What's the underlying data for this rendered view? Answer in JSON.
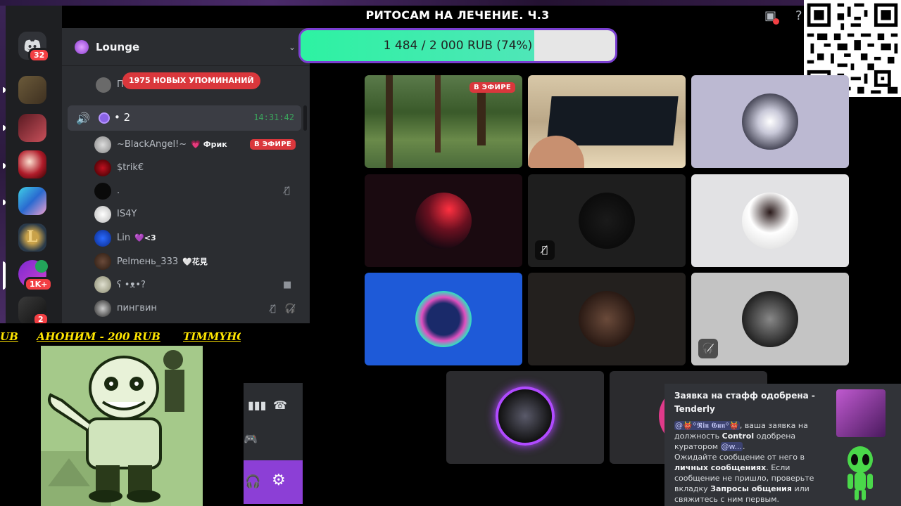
{
  "stream": {
    "title": "РИТОСАМ НА ЛЕЧЕНИЕ. Ч.3",
    "goal_text": "1 484 / 2 000 RUB (74%)",
    "goal_fraction": 0.742
  },
  "rail": {
    "discord_badge": "32",
    "server_badge_1": "1K+",
    "server_badge_2": "2"
  },
  "guild": {
    "name": "Lounge"
  },
  "mentions_pill": "1975 НОВЫХ УПОМИНАНИЙ",
  "partial_member": "П",
  "voice_channel": {
    "name": "• 2",
    "timer": "14:31:42"
  },
  "members": [
    {
      "name": "~BlackAngel!~",
      "tag": "💗 Фрик",
      "live": "В ЭФИРЕ"
    },
    {
      "name": "$trik€",
      "tag": ""
    },
    {
      "name": ".",
      "tag": ""
    },
    {
      "name": "IS4Y",
      "tag": ""
    },
    {
      "name": "Lin",
      "tag": "💜<3"
    },
    {
      "name": "Pelmeнь_333",
      "tag": "🤍花見"
    },
    {
      "name": "ʕ •ᴥ•?",
      "tag": ""
    },
    {
      "name": "пингвин",
      "tag": ""
    }
  ],
  "tiles": {
    "live_badge": "В ЭФИРЕ"
  },
  "ticker": {
    "left_fragment": "UB",
    "item": "АНОНИМ - 200 RUB",
    "right_fragment": "TIMMYHC"
  },
  "notification": {
    "title": "Заявка на стафф одобрена - Tenderly",
    "mention": "@👹꙳𝕽𝖎𝖓 𝕲𝖚𝖓꙳👹",
    "line1": ", ваша заявка на должность ",
    "role": "Control",
    "line2": " одобрена куратором ",
    "curator": "@w...",
    "line3": ".",
    "line4": "Ожидайте сообщение от него в ",
    "dm": "личных сообщениях",
    "line5": ". Если сообщение не пришло, проверьте вкладку ",
    "tab": "Запросы общения",
    "line6": " или свяжитесь с ним первым."
  },
  "colors": {
    "accent": "#8c3fd6",
    "live_red": "#da373c",
    "goal_fill": "#2df2a2",
    "ticker_yellow": "#ffe600"
  }
}
